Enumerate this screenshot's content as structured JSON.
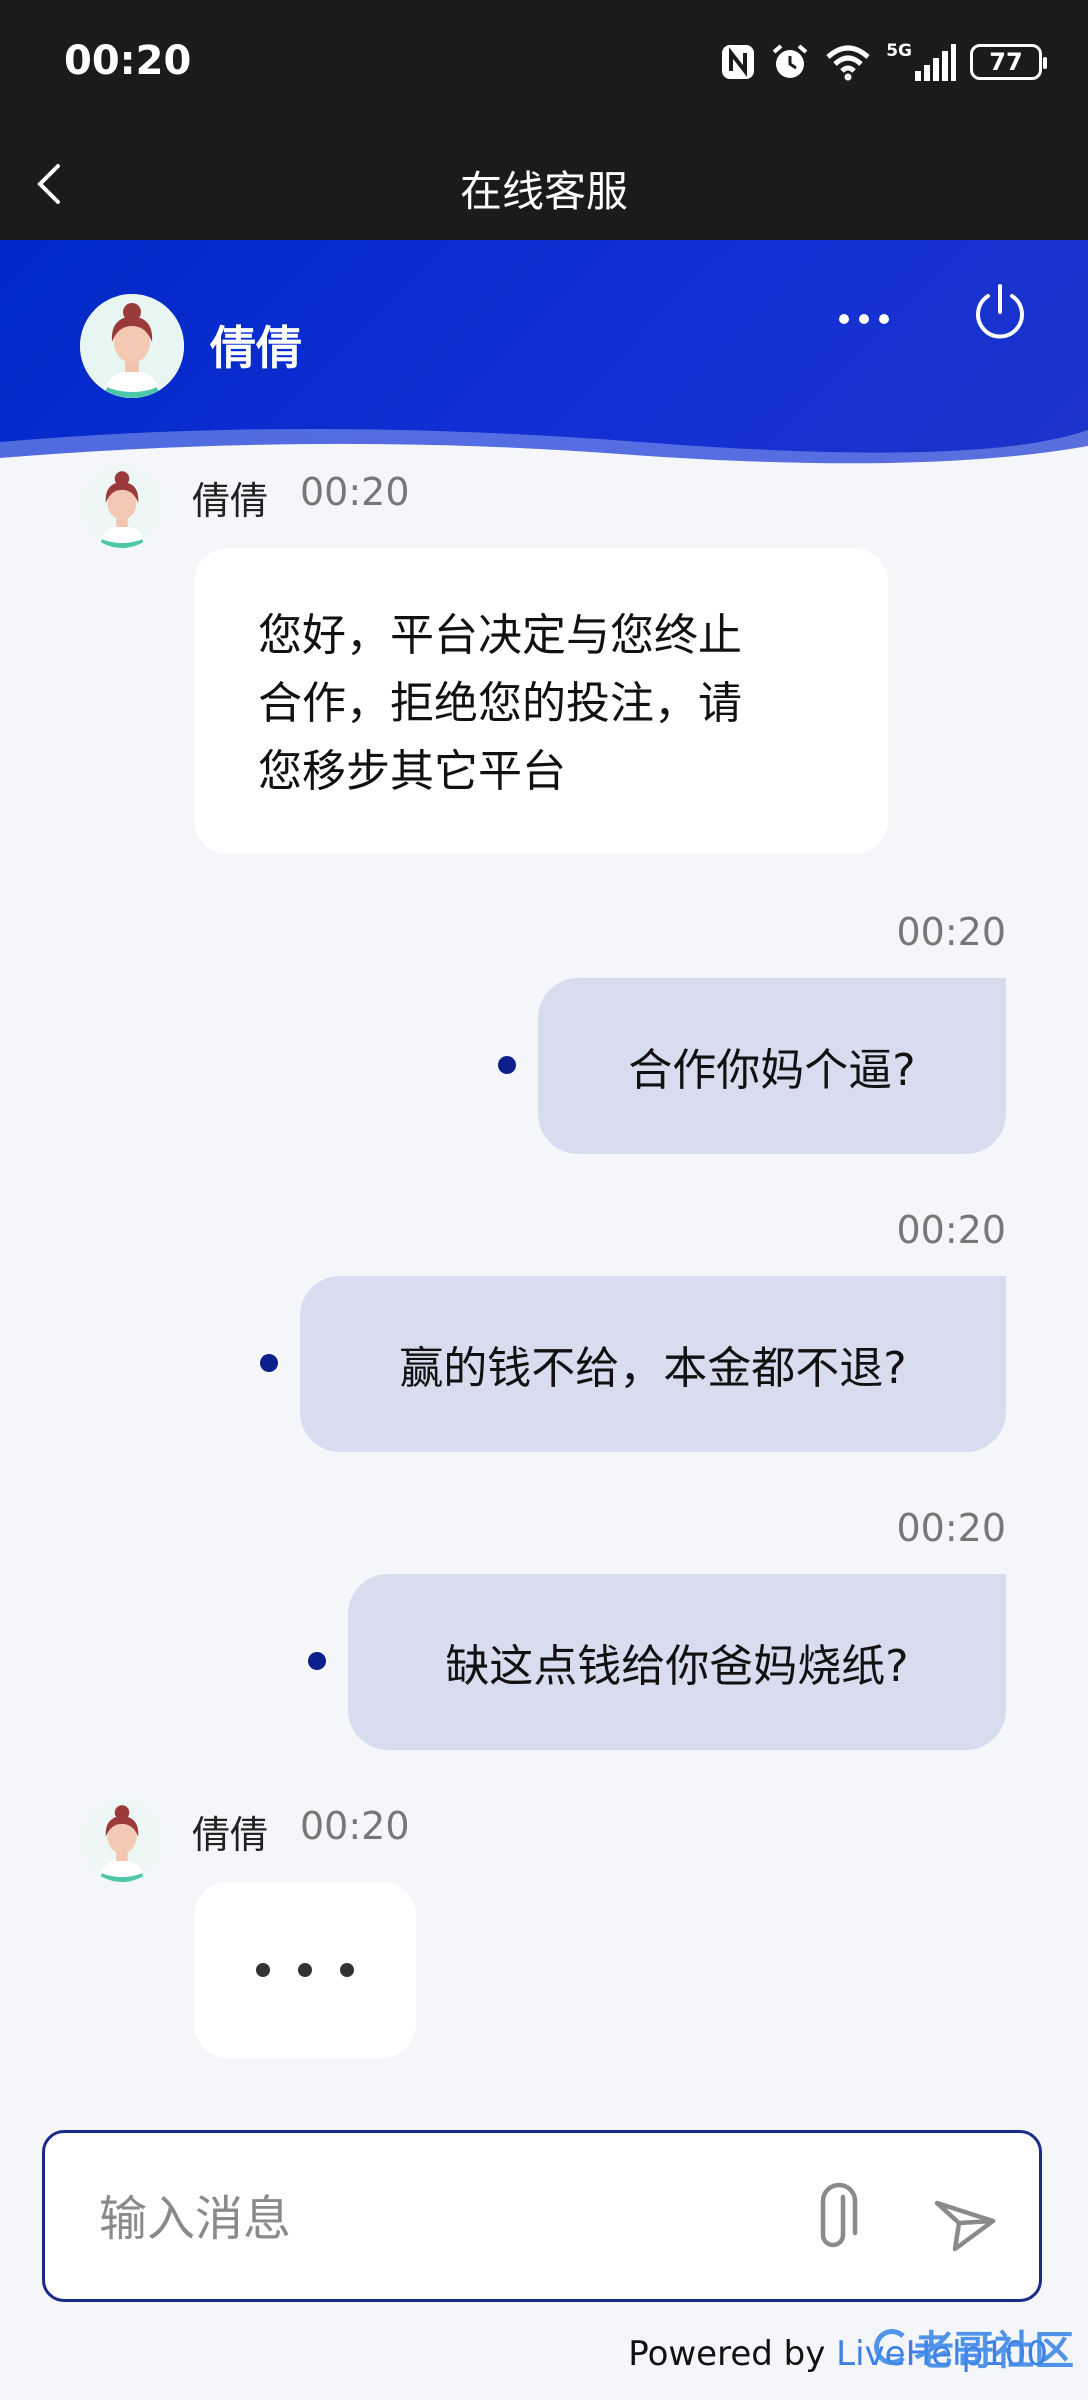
{
  "status_bar": {
    "time": "00:20",
    "signal_label": "5G",
    "battery": "77"
  },
  "nav": {
    "title": "在线客服"
  },
  "header": {
    "agent_name": "倩倩"
  },
  "messages": [
    {
      "sender": "倩倩",
      "time": "00:20",
      "text_lines": [
        "您好，平台决定与您终止",
        "合作，拒绝您的投注，请",
        "您移步其它平台"
      ]
    },
    {
      "time": "00:20",
      "text": "合作你妈个逼?"
    },
    {
      "time": "00:20",
      "text": "赢的钱不给，本金都不退?"
    },
    {
      "time": "00:20",
      "text": "缺这点钱给你爸妈烧纸?"
    },
    {
      "sender": "倩倩",
      "time": "00:20",
      "typing": true
    }
  ],
  "composer": {
    "placeholder": "输入消息"
  },
  "footer": {
    "powered_prefix": "Powered by",
    "brand": "LiveHelp100",
    "watermark": "老哥社区"
  },
  "colors": {
    "header_blue": "#1430d4",
    "outgoing_bubble": "#d8dcef",
    "accent_navy": "#0c1f8c"
  }
}
